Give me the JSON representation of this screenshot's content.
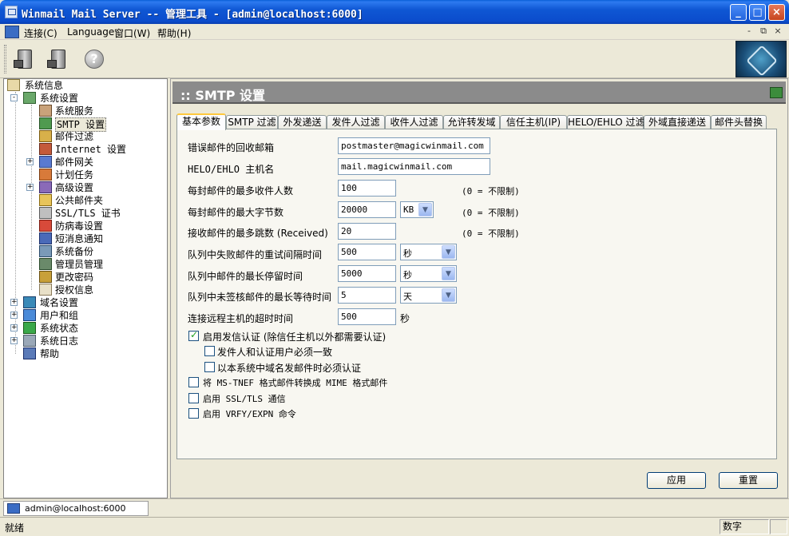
{
  "window": {
    "title": "Winmail Mail Server -- 管理工具 - [admin@localhost:6000]",
    "min_glyph": "_",
    "max_glyph": "□",
    "close_glyph": "×"
  },
  "menu": {
    "items": [
      "连接(C)",
      "Language",
      "窗口(W)",
      "帮助(H)"
    ],
    "mdi": [
      "-",
      "⧉",
      "×"
    ]
  },
  "toolbar": {
    "buttons": [
      "connect-server-icon",
      "disconnect-server-icon",
      "help-icon"
    ],
    "help_glyph": "?"
  },
  "tree": {
    "items": [
      {
        "label": "系统信息",
        "level": 0,
        "icon": "info-icon",
        "expander": ""
      },
      {
        "label": "系统设置",
        "level": 1,
        "icon": "settings-icon",
        "expander": "-"
      },
      {
        "label": "系统服务",
        "level": 2,
        "icon": "service-icon",
        "expander": ""
      },
      {
        "label": "SMTP 设置",
        "level": 2,
        "icon": "smtp-icon",
        "expander": "",
        "selected": true
      },
      {
        "label": "邮件过滤",
        "level": 2,
        "icon": "filter-icon",
        "expander": ""
      },
      {
        "label": "Internet 设置",
        "level": 2,
        "icon": "internet-icon",
        "expander": ""
      },
      {
        "label": "邮件网关",
        "level": 2,
        "icon": "gateway-icon",
        "expander": "+"
      },
      {
        "label": "计划任务",
        "level": 2,
        "icon": "schedule-icon",
        "expander": ""
      },
      {
        "label": "高级设置",
        "level": 2,
        "icon": "advanced-icon",
        "expander": "+"
      },
      {
        "label": "公共邮件夹",
        "level": 2,
        "icon": "folder-icon",
        "expander": ""
      },
      {
        "label": "SSL/TLS 证书",
        "level": 2,
        "icon": "certificate-icon",
        "expander": ""
      },
      {
        "label": "防病毒设置",
        "level": 2,
        "icon": "antivirus-icon",
        "expander": ""
      },
      {
        "label": "短消息通知",
        "level": 2,
        "icon": "sms-icon",
        "expander": ""
      },
      {
        "label": "系统备份",
        "level": 2,
        "icon": "backup-icon",
        "expander": ""
      },
      {
        "label": "管理员管理",
        "level": 2,
        "icon": "admin-icon",
        "expander": ""
      },
      {
        "label": "更改密码",
        "level": 2,
        "icon": "password-icon",
        "expander": ""
      },
      {
        "label": "授权信息",
        "level": 2,
        "icon": "license-icon",
        "expander": ""
      },
      {
        "label": "域名设置",
        "level": 1,
        "icon": "domain-icon",
        "expander": "+"
      },
      {
        "label": "用户和组",
        "level": 1,
        "icon": "users-icon",
        "expander": "+"
      },
      {
        "label": "系统状态",
        "level": 1,
        "icon": "status-icon",
        "expander": "+"
      },
      {
        "label": "系统日志",
        "level": 1,
        "icon": "log-icon",
        "expander": "+"
      },
      {
        "label": "帮助",
        "level": 1,
        "icon": "help-book-icon",
        "expander": ""
      }
    ]
  },
  "panel": {
    "title": ":: SMTP 设置"
  },
  "tabs": [
    "基本参数",
    "SMTP 过滤",
    "外发递送",
    "发件人过滤",
    "收件人过滤",
    "允许转发域",
    "信任主机(IP)",
    "HELO/EHLO 过滤",
    "外域直接递送",
    "邮件头替换"
  ],
  "form": {
    "bounce_mailbox": {
      "label": "错误邮件的回收邮箱",
      "value": "postmaster@magicwinmail.com"
    },
    "helo_host": {
      "label": "HELO/EHLO 主机名",
      "value": "mail.magicwinmail.com"
    },
    "max_recipients": {
      "label": "每封邮件的最多收件人数",
      "value": "100",
      "hint": "(0 = 不限制)"
    },
    "max_size": {
      "label": "每封邮件的最大字节数",
      "value": "20000",
      "unit": "KB",
      "hint": "(0 = 不限制)"
    },
    "max_hops": {
      "label": "接收邮件的最多跳数 (Received)",
      "value": "20",
      "hint": "(0 = 不限制)"
    },
    "retry_interval": {
      "label": "队列中失败邮件的重试间隔时间",
      "value": "500",
      "unit": "秒"
    },
    "max_queue_time": {
      "label": "队列中邮件的最长停留时间",
      "value": "5000",
      "unit": "秒"
    },
    "max_unapproved_wait": {
      "label": "队列中未签核邮件的最长等待时间",
      "value": "5",
      "unit": "天"
    },
    "connect_timeout": {
      "label": "连接远程主机的超时时间",
      "value": "500",
      "unit": "秒"
    }
  },
  "checkboxes": {
    "smtp_auth": {
      "label": "启用发信认证 (除信任主机以外都需要认证)",
      "checked": true
    },
    "sender_match_auth": {
      "label": "发件人和认证用户必须一致",
      "checked": false
    },
    "local_domain_auth": {
      "label": "以本系统中域名发邮件时必须认证",
      "checked": false
    },
    "tnef_convert": {
      "label": "将 MS-TNEF 格式邮件转换成 MIME 格式邮件",
      "checked": false
    },
    "ssl_tls": {
      "label": "启用 SSL/TLS 通信",
      "checked": false
    },
    "vrfy_expn": {
      "label": "启用 VRFY/EXPN 命令",
      "checked": false
    }
  },
  "buttons": {
    "apply": "应用",
    "reset": "重置"
  },
  "doc_tab": {
    "label": "admin@localhost:6000"
  },
  "status": {
    "text": "就绪",
    "numlock": "数字"
  }
}
